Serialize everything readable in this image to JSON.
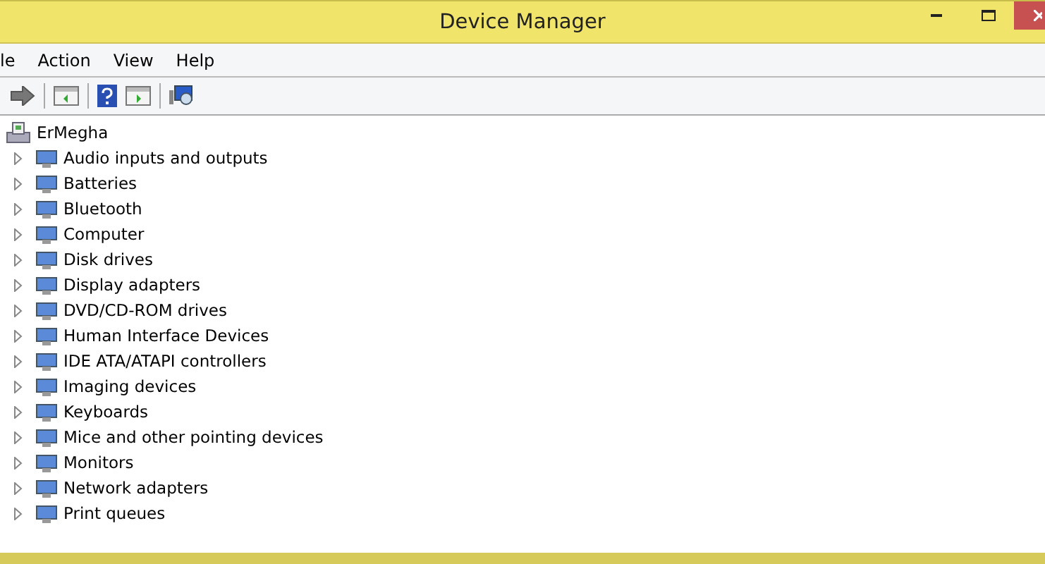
{
  "window": {
    "title": "Device Manager"
  },
  "menu": [
    "le",
    "Action",
    "View",
    "Help"
  ],
  "tree": {
    "label": "ErMegha",
    "children": [
      {
        "label": "Audio inputs and outputs",
        "expanded": false
      },
      {
        "label": "Batteries",
        "expanded": false
      },
      {
        "label": "Bluetooth",
        "expanded": false
      },
      {
        "label": "Computer",
        "expanded": false
      },
      {
        "label": "Disk drives",
        "expanded": false
      },
      {
        "label": "Display adapters",
        "expanded": false
      },
      {
        "label": "DVD/CD-ROM drives",
        "expanded": false
      },
      {
        "label": "Human Interface Devices",
        "expanded": false
      },
      {
        "label": "IDE ATA/ATAPI controllers",
        "expanded": false
      },
      {
        "label": "Imaging devices",
        "expanded": false
      },
      {
        "label": "Keyboards",
        "expanded": false
      },
      {
        "label": "Mice and other pointing devices",
        "expanded": false
      },
      {
        "label": "Monitors",
        "expanded": false
      },
      {
        "label": "Network adapters",
        "expanded": false
      },
      {
        "label": "Print queues",
        "expanded": false
      }
    ]
  }
}
